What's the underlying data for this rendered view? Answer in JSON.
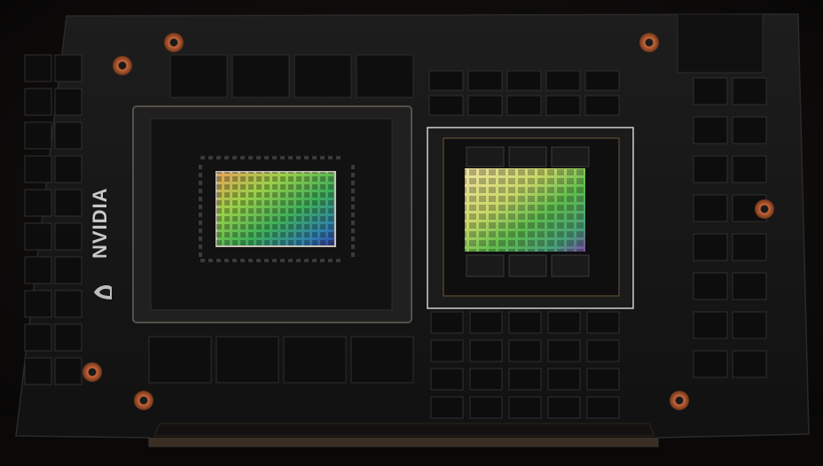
{
  "brand": {
    "logo_text": "NVIDIA",
    "logo_icon": "nvidia-eye-icon"
  },
  "colors": {
    "board": "#161616",
    "board_edge": "#242424",
    "background": "#090807",
    "module": "#101010",
    "copper_ring": "#b85a35",
    "gold_trim": "#6b5838"
  }
}
